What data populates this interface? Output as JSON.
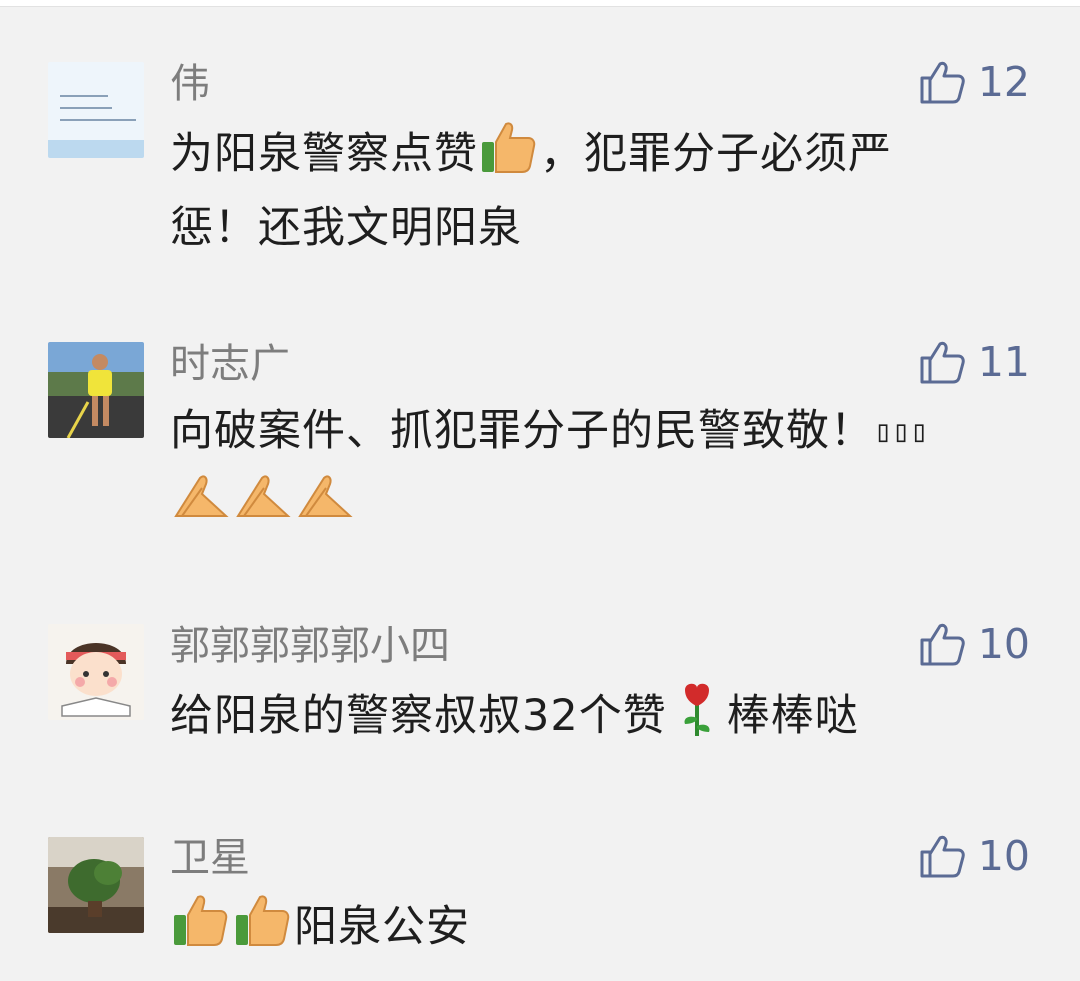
{
  "comments": [
    {
      "author": "伟",
      "avatar_icon": "text-note-avatar",
      "likes": "12",
      "text_lines": [
        "为阳泉警察点赞",
        "，犯罪分子必须严",
        "惩！还我文明阳泉"
      ],
      "emojis": [
        "thumbs-up-emoji"
      ]
    },
    {
      "author": "时志广",
      "avatar_icon": "runner-photo-avatar",
      "likes": "11",
      "text_lines": [
        "向破案件、抓犯罪分子的民警致敬！",
        "▯▯▯"
      ],
      "emojis": [
        "praying-hands-emoji",
        "praying-hands-emoji",
        "praying-hands-emoji"
      ]
    },
    {
      "author": "郭郭郭郭郭小四",
      "avatar_icon": "cartoon-girl-avatar",
      "likes": "10",
      "text_lines": [
        "给阳泉的警察叔叔32个赞",
        "棒棒哒"
      ],
      "emojis": [
        "rose-emoji"
      ]
    },
    {
      "author": "卫星",
      "avatar_icon": "plant-photo-avatar",
      "likes": "10",
      "text_lines": [
        "阳泉公安"
      ],
      "emojis": [
        "thumbs-up-emoji",
        "thumbs-up-emoji"
      ]
    }
  ],
  "colors": {
    "name": "#7d7d7d",
    "text": "#1e1e1e",
    "like": "#5b6b94",
    "background": "#f2f2f2"
  }
}
